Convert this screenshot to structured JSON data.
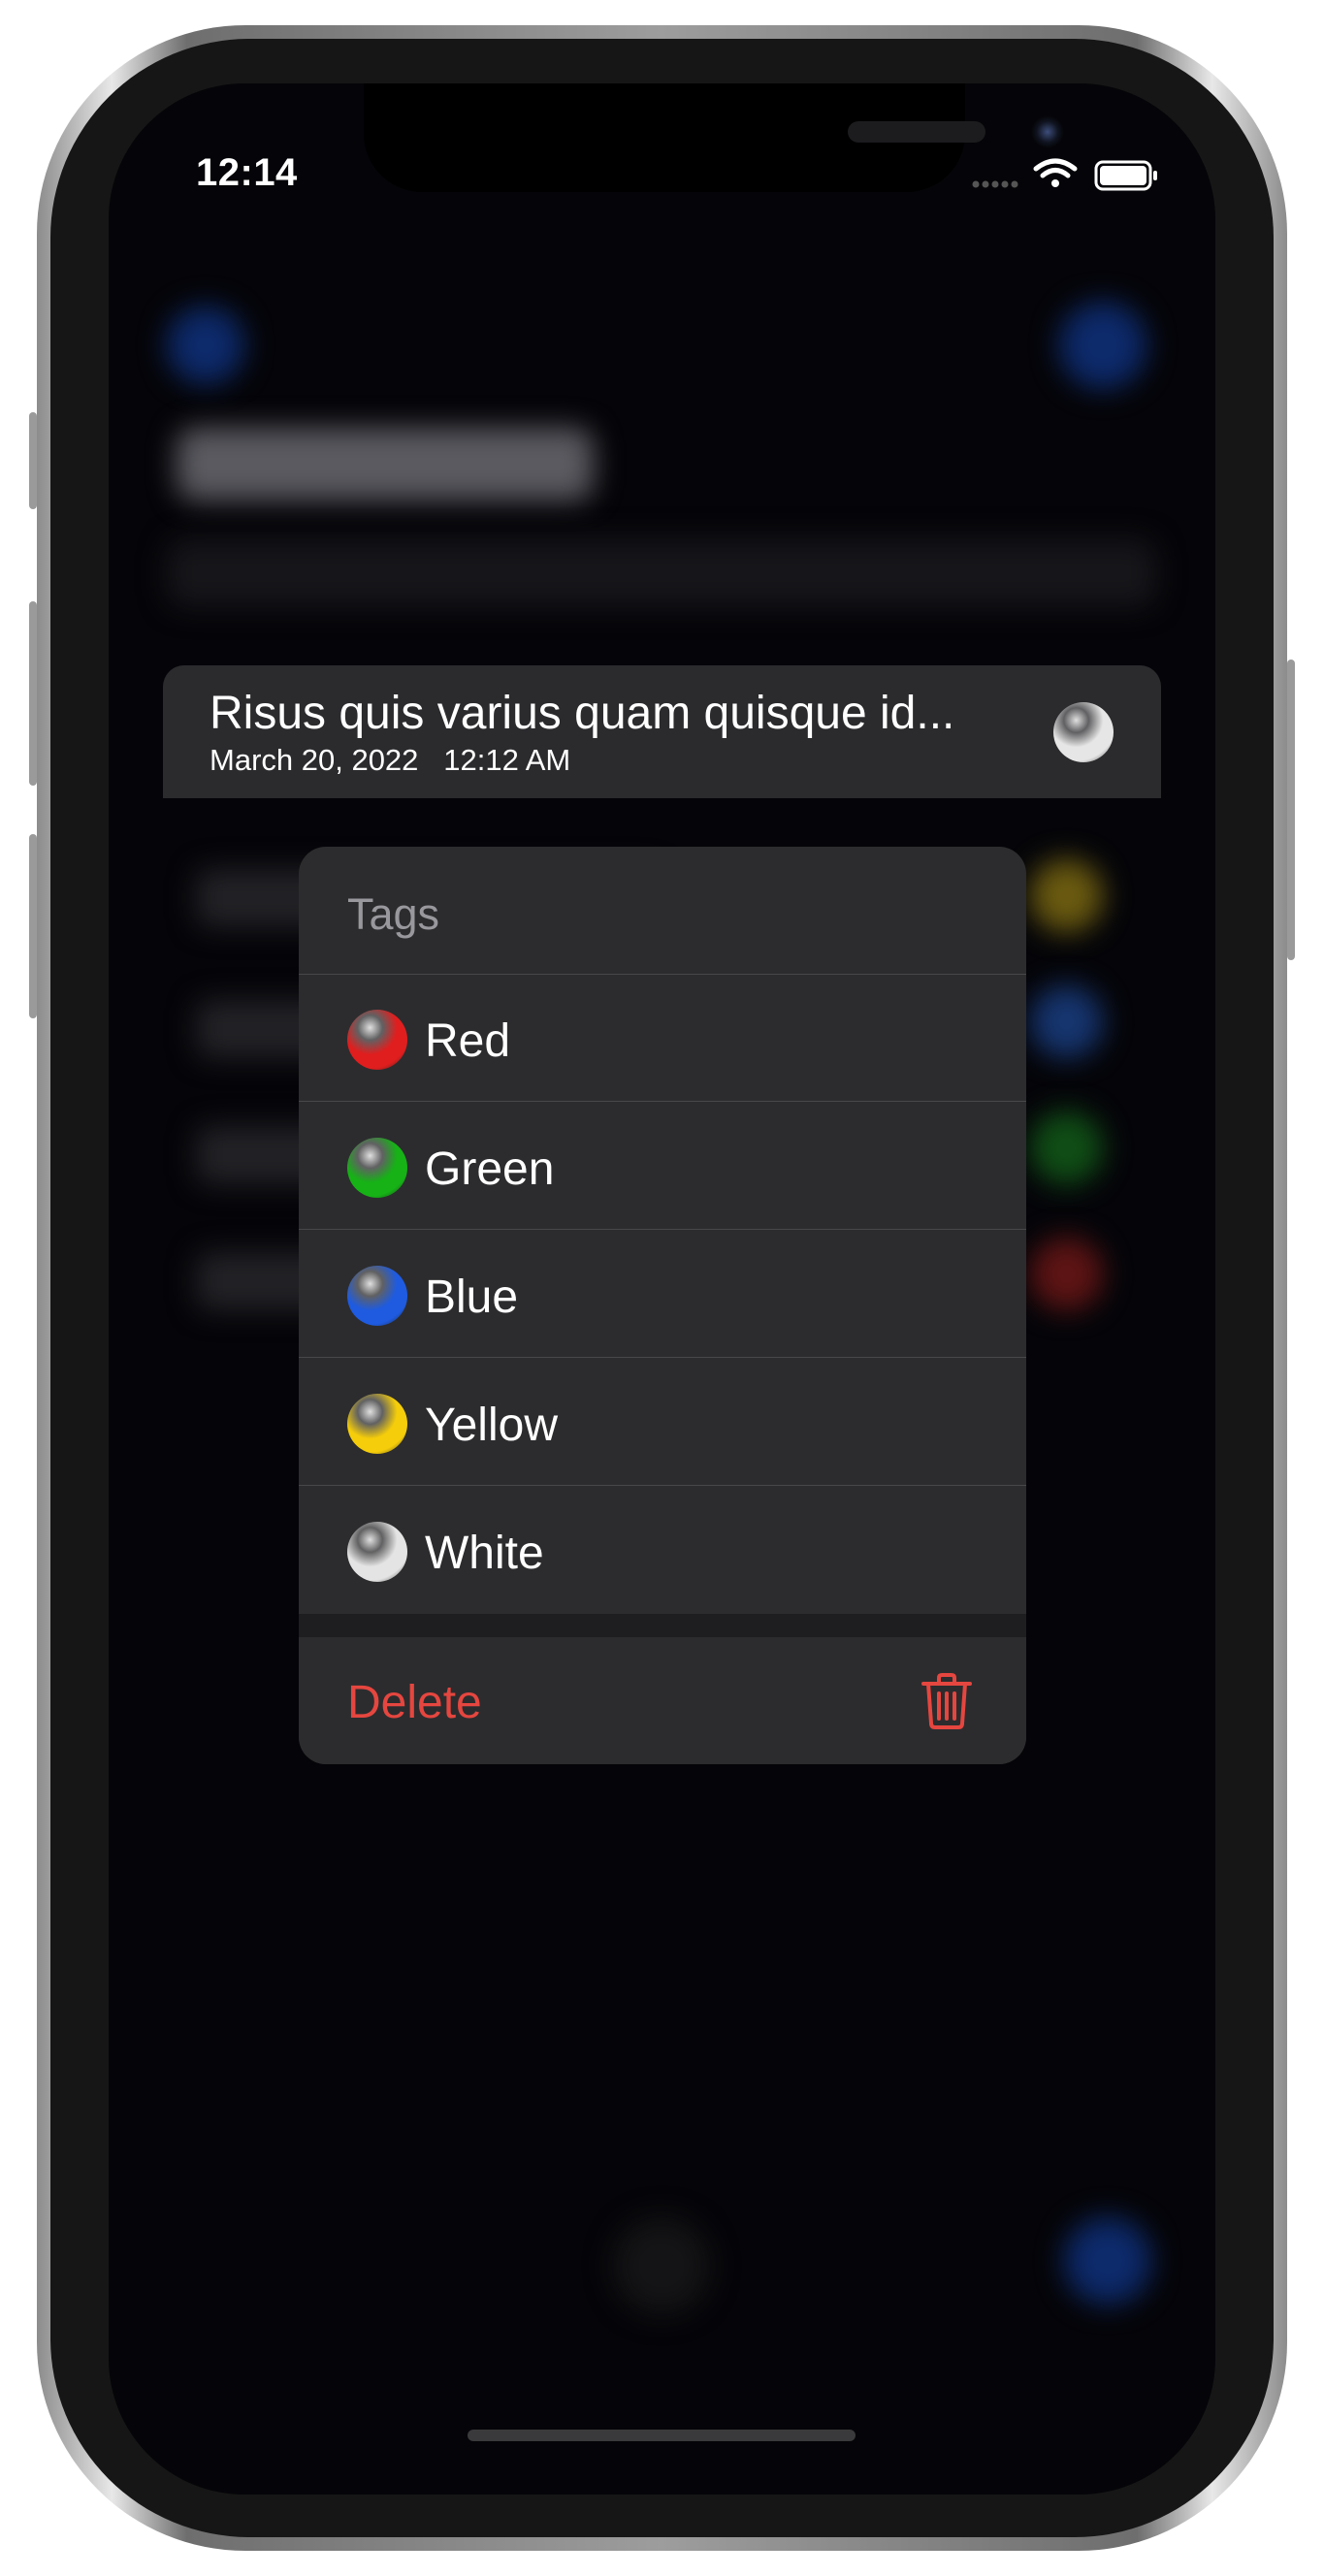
{
  "status_bar": {
    "time": "12:14"
  },
  "preview": {
    "title": "Risus quis varius quam quisque id...",
    "date": "March 20, 2022",
    "time": "12:12 AM",
    "tag_color": "#e6e6e6",
    "tag_icon": "white-tag-dot-icon"
  },
  "menu": {
    "header": "Tags",
    "tags": [
      {
        "label": "Red",
        "color": "#e01e1e",
        "icon": "red-dot-icon"
      },
      {
        "label": "Green",
        "color": "#16b216",
        "icon": "green-dot-icon"
      },
      {
        "label": "Blue",
        "color": "#1e5be0",
        "icon": "blue-dot-icon"
      },
      {
        "label": "Yellow",
        "color": "#f5cd0a",
        "icon": "yellow-dot-icon"
      },
      {
        "label": "White",
        "color": "#e4e4e4",
        "icon": "white-dot-icon"
      }
    ],
    "delete_label": "Delete",
    "delete_icon": "trash-icon",
    "delete_color": "#e5463f"
  }
}
